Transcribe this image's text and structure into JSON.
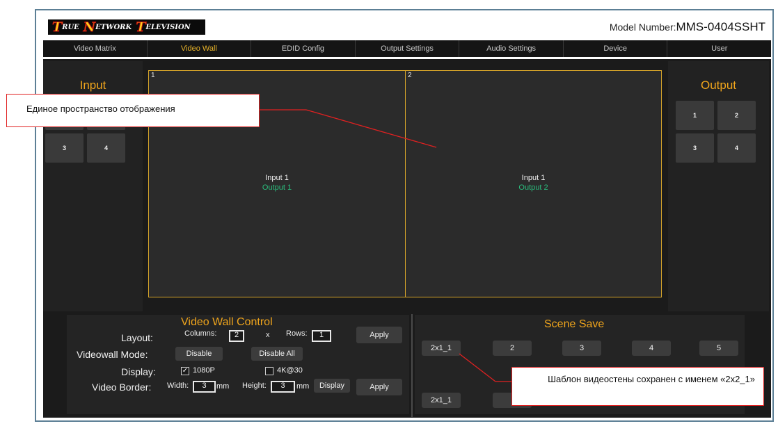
{
  "header": {
    "logo_words": [
      {
        "cap": "T",
        "rest": "rue"
      },
      {
        "cap": "N",
        "rest": "etwork"
      },
      {
        "cap": "T",
        "rest": "elevision"
      }
    ],
    "model_label": "Model Number:",
    "model_value": "MMS-0404SSHT"
  },
  "nav": {
    "tabs": [
      "Video Matrix",
      "Video Wall",
      "EDID Config",
      "Output Settings",
      "Audio Settings",
      "Device",
      "User"
    ],
    "active_tab": "Video Wall"
  },
  "input_panel": {
    "title": "Input",
    "buttons": [
      "1",
      "2",
      "3",
      "4"
    ]
  },
  "output_panel": {
    "title": "Output",
    "buttons": [
      "1",
      "2",
      "3",
      "4"
    ]
  },
  "wall": {
    "cells": [
      {
        "number": "1",
        "input": "Input 1",
        "output": "Output 1"
      },
      {
        "number": "2",
        "input": "Input 1",
        "output": "Output 2"
      }
    ],
    "border_color": "#d9a62a",
    "output_text_color": "#2bbf7e"
  },
  "video_wall_control": {
    "title": "Video Wall Control",
    "layout_label": "Layout:",
    "columns_label": "Columns:",
    "columns_value": "2",
    "times": "x",
    "rows_label": "Rows:",
    "rows_value": "1",
    "apply1": "Apply",
    "mode_label": "Videowall Mode:",
    "disable": "Disable",
    "disable_all": "Disable All",
    "display_label": "Display:",
    "opt_1080p": "1080P",
    "opt_1080p_checked": true,
    "opt_4k": "4K@30",
    "opt_4k_checked": false,
    "border_label": "Video Border:",
    "width_label": "Width:",
    "width_value": "3",
    "mm": "mm",
    "height_label": "Height:",
    "height_value": "3",
    "display_btn": "Display",
    "apply2": "Apply"
  },
  "scene_save": {
    "title": "Scene Save",
    "row1": [
      "2x1_1",
      "2",
      "3",
      "4",
      "5"
    ],
    "row2_first": "2x1_1"
  },
  "callouts": {
    "display_space": "Единое пространство отображения",
    "template_saved": "Шаблон видеостены сохранен с именем «2x2_1»"
  },
  "colors": {
    "accent": "#f0a51c",
    "callout_border": "#e02121"
  }
}
